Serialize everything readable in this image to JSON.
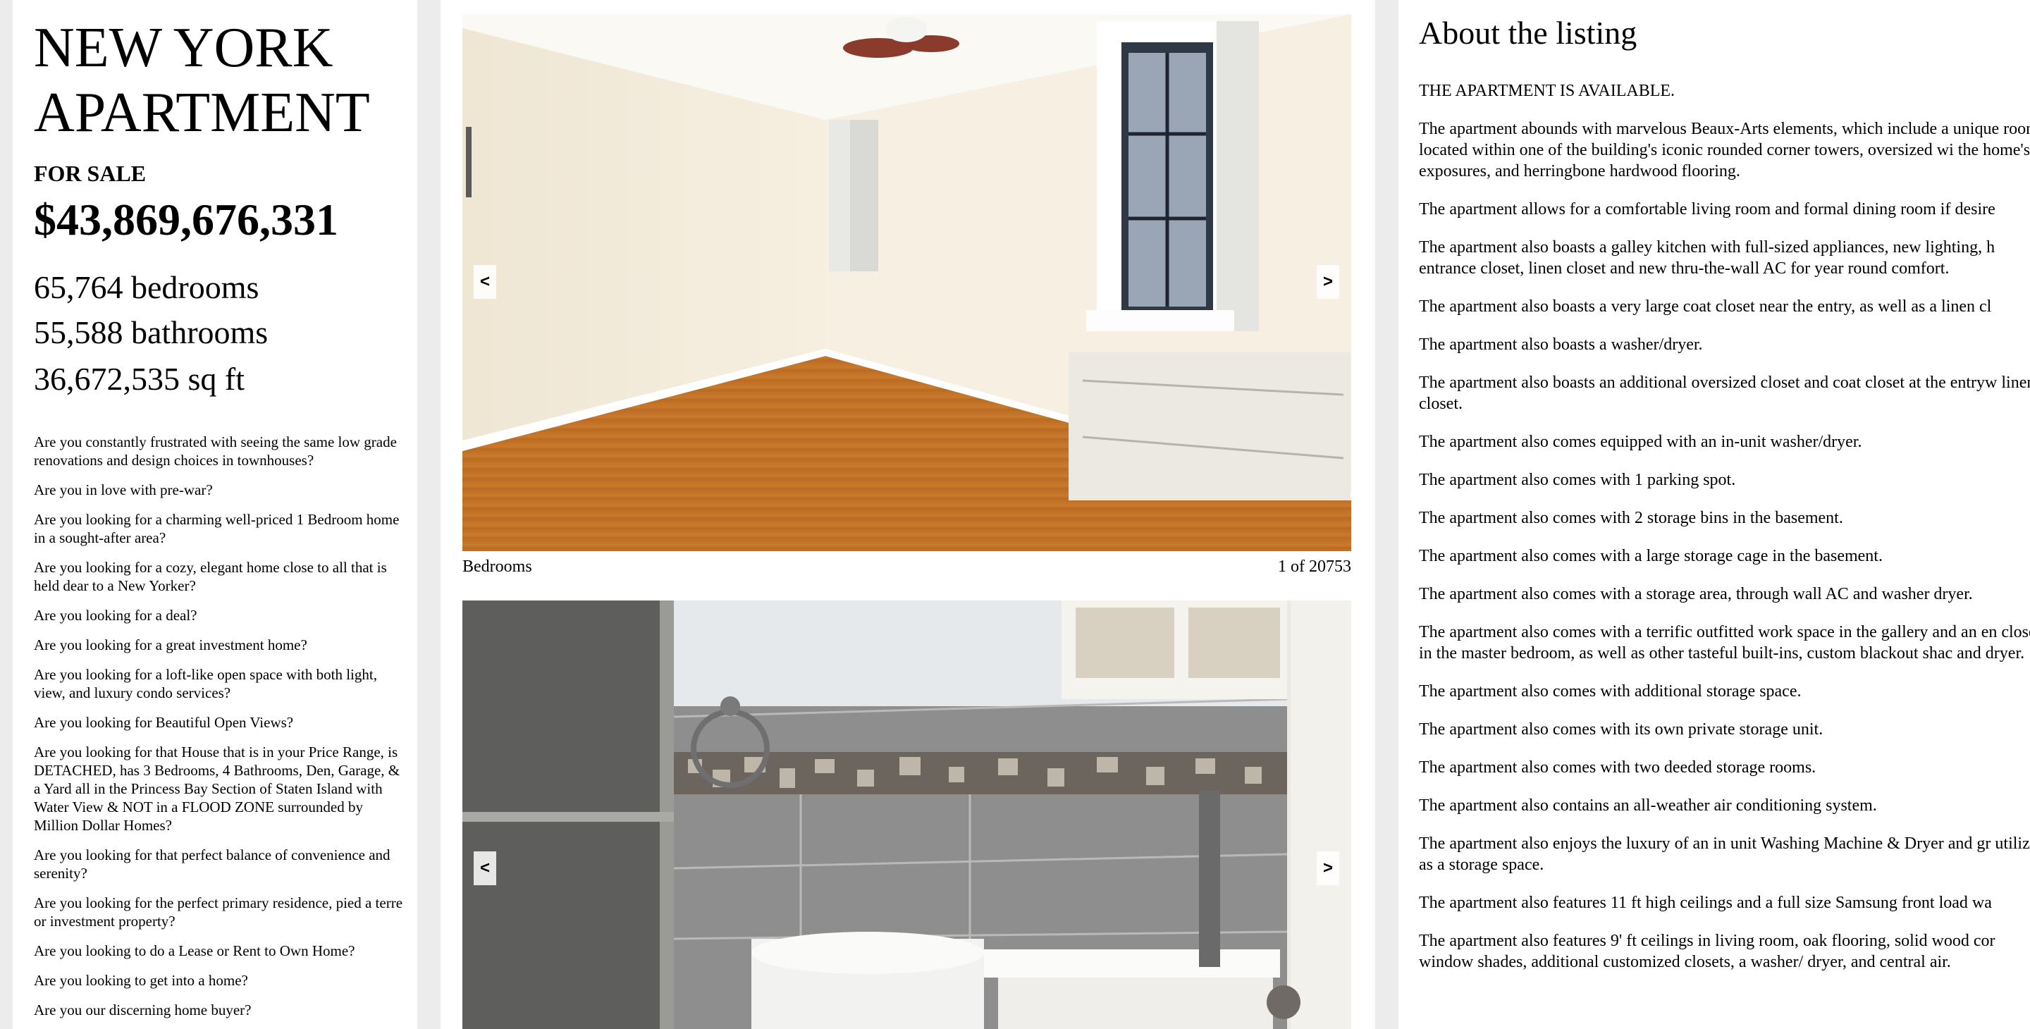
{
  "listing": {
    "title": "NEW YORK APARTMENT",
    "status": "FOR SALE",
    "price": "$43,869,676,331",
    "bedrooms": "65,764 bedrooms",
    "bathrooms": "55,588 bathrooms",
    "area": "36,672,535 sq ft"
  },
  "questions": [
    "Are you constantly frustrated with seeing the same low grade renovations and design choices in townhouses?",
    "Are you in love with pre-war?",
    "Are you looking for a charming well-priced 1 Bedroom home in a sought-after area?",
    "Are you looking for a cozy, elegant home close to all that is held dear to a New Yorker?",
    "Are you looking for a deal?",
    "Are you looking for a great investment home?",
    "Are you looking for a loft-like open space with both light, view, and luxury condo services?",
    "Are you looking for Beautiful Open Views?",
    "Are you looking for that House that is in your Price Range, is DETACHED, has 3 Bedrooms, 4 Bathrooms, Den, Garage, & a Yard all in the Princess Bay Section of Staten Island with Water View & NOT in a FLOOD ZONE surrounded by Million Dollar Homes?",
    "Are you looking for that perfect balance of convenience and serenity?",
    "Are you looking for the perfect primary residence, pied a terre or investment property?",
    "Are you looking to do a Lease or Rent to Own Home?",
    "Are you looking to get into a home?",
    "Are you our discerning home buyer?"
  ],
  "gallery": {
    "prev_label": "<",
    "next_label": ">",
    "photos": [
      {
        "caption": "Bedrooms",
        "counter": "1 of 20753"
      },
      {
        "caption": "",
        "counter": ""
      }
    ]
  },
  "about": {
    "heading": "About the listing",
    "paragraphs": [
      "THE APARTMENT IS AVAILABLE.",
      "The apartment abounds with marvelous Beaux-Arts elements, which include a unique room located within one of the building's iconic rounded corner towers, oversized wi the home's exposures, and herringbone hardwood flooring.",
      "The apartment allows for a comfortable living room and formal dining room if desire",
      "The apartment also boasts a galley kitchen with full-sized appliances, new lighting, h entrance closet, linen closet and new thru-the-wall AC for year round comfort.",
      "The apartment also boasts a very large coat closet near the entry, as well as a linen cl",
      "The apartment also boasts a washer/dryer.",
      "The apartment also boasts an additional oversized closet and coat closet at the entryw linen closet.",
      "The apartment also comes equipped with an in-unit washer/dryer.",
      "The apartment also comes with 1 parking spot.",
      "The apartment also comes with 2 storage bins in the basement.",
      "The apartment also comes with a large storage cage in the basement.",
      "The apartment also comes with a storage area, through wall AC and washer dryer.",
      "The apartment also comes with a terrific outfitted work space in the gallery and an en closet in the master bedroom, as well as other tasteful built-ins, custom blackout shac and dryer.",
      "The apartment also comes with additional storage space.",
      "The apartment also comes with its own private storage unit.",
      "The apartment also comes with two deeded storage rooms.",
      "The apartment also contains an all-weather air conditioning system.",
      "The apartment also enjoys the luxury of an in unit Washing Machine & Dryer and gr utilized as a storage space.",
      "The apartment also features 11 ft high ceilings and a full size Samsung front load wa",
      "The apartment also features 9' ft ceilings in living room, oak flooring, solid wood cor window shades, additional customized closets, a washer/ dryer, and central air."
    ]
  }
}
